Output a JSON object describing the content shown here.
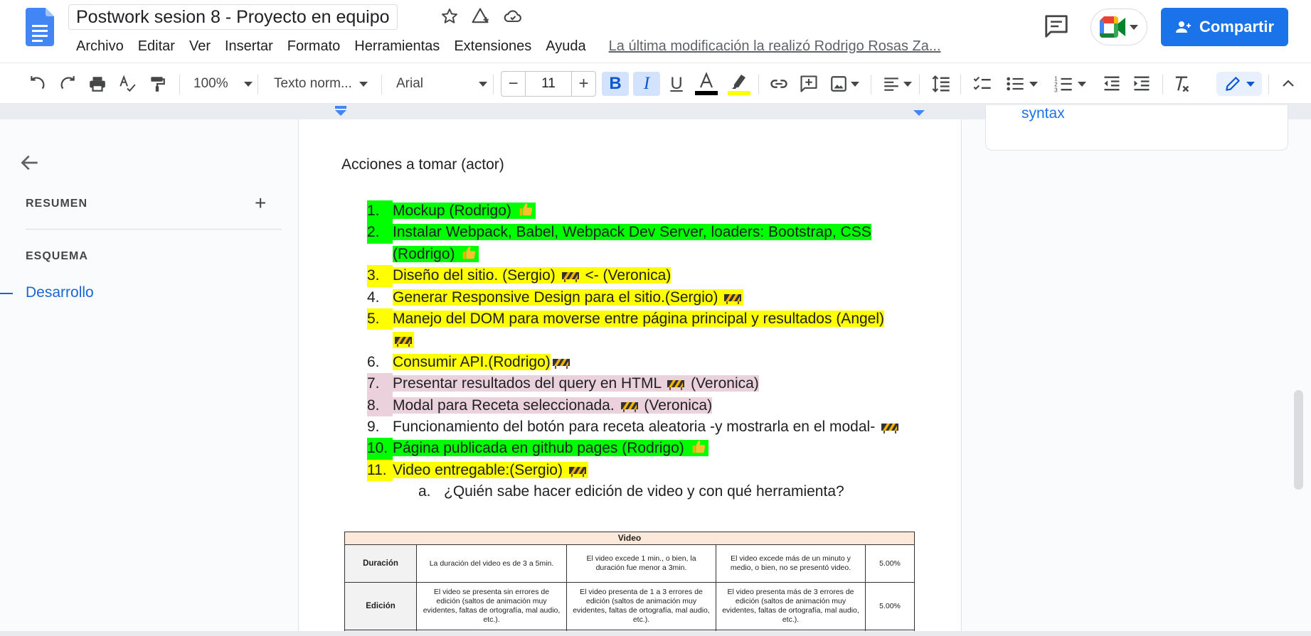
{
  "document": {
    "title": "Postwork sesion 8 - Proyecto en equipo",
    "last_edit": "La última modificación la realizó Rodrigo Rosas Za..."
  },
  "menu": [
    "Archivo",
    "Editar",
    "Ver",
    "Insertar",
    "Formato",
    "Herramientas",
    "Extensiones",
    "Ayuda"
  ],
  "header": {
    "share_label": "Compartir"
  },
  "toolbar": {
    "zoom": "100%",
    "style": "Texto norm...",
    "font": "Arial",
    "font_size": "11"
  },
  "sidebar": {
    "summary_label": "RESUMEN",
    "outline_label": "ESQUEMA",
    "outline_items": [
      "Desarrollo"
    ]
  },
  "right_panel": {
    "text": "syntax"
  },
  "content": {
    "heading": "Acciones a tomar (actor)",
    "items": [
      {
        "num": "1.",
        "text": "Mockup (Rodrigo)",
        "highlight": "green",
        "mark": "thumbs-up"
      },
      {
        "num": "2.",
        "text": "Instalar Webpack, Babel, Webpack Dev Server, loaders: Bootstrap, CSS (Rodrigo)",
        "highlight": "green",
        "mark": "thumbs-up"
      },
      {
        "num": "3.",
        "text": "Diseño del sitio. (Sergio)",
        "text2": "<- (Veronica)",
        "highlight": "yellow",
        "mark": "construction-mid"
      },
      {
        "num": "4.",
        "text": "Generar Responsive Design para el sitio.(Sergio)",
        "highlight": "yellow",
        "numhl": "none",
        "mark": "construction"
      },
      {
        "num": "5.",
        "text": "Manejo del DOM para moverse entre página principal y resultados (Angel)",
        "highlight": "yellow",
        "mark": "construction"
      },
      {
        "num": "6.",
        "text": "Consumir API.(Rodrigo)",
        "highlight": "yellow",
        "numhl": "none",
        "mark": "construction-out"
      },
      {
        "num": "7.",
        "text": "Presentar resultados del query en HTML",
        "text2": "(Veronica)",
        "highlight": "pink",
        "mark": "construction-mid"
      },
      {
        "num": "8.",
        "text": "Modal para Receta seleccionada.",
        "text2": "(Veronica)",
        "highlight": "pink",
        "mark": "construction-mid"
      },
      {
        "num": "9.",
        "text": "Funcionamiento del botón para receta aleatoria -y mostrarla en el modal-",
        "highlight": "none",
        "mark": "construction"
      },
      {
        "num": "10.",
        "text": "Página publicada en github pages (Rodrigo)",
        "highlight": "green",
        "mark": "thumbs-up"
      },
      {
        "num": "11.",
        "text": "Video entregable:(Sergio)",
        "highlight": "yellow",
        "mark": "construction"
      }
    ],
    "subitem": {
      "num": "a.",
      "text": "¿Quién sabe hacer edición de video y con qué herramienta?"
    }
  },
  "rubric": {
    "title": "Video",
    "rows": [
      {
        "criterion": "Duración",
        "c1": "La duración del video es de 3 a 5min.",
        "c2": "El video excede 1 min., o bien, la duración fue menor a 3min.",
        "c3": "El video excede más de un minuto y medio, o bien, no se presentó video.",
        "weight": "5.00%"
      },
      {
        "criterion": "Edición",
        "c1": "El video se presenta sin errores de edición (saltos de animación muy evidentes, faltas de ortografía, mal audio, etc.).",
        "c2": "El video presenta de 1 a 3 errores de edición (saltos de animación muy evidentes, faltas de ortografía, mal audio, etc.).",
        "c3": "El video presenta más de 3 errores de edición (saltos de animación muy evidentes, faltas de ortografía, mal audio, etc.).",
        "weight": "5.00%"
      }
    ]
  },
  "colors": {
    "accent": "#1a73e8",
    "green_highlight": "#00ff00",
    "yellow_highlight": "#ffff00",
    "pink_highlight": "#ead1dc"
  }
}
